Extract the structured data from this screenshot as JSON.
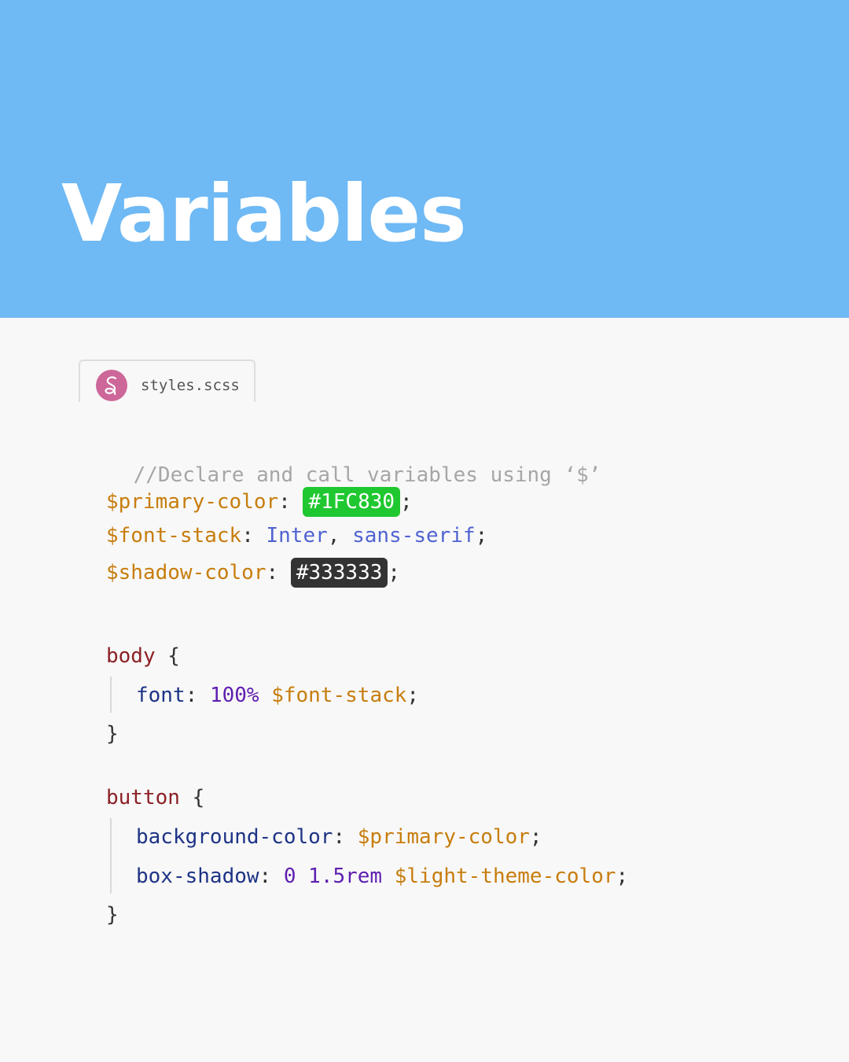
{
  "header": {
    "title": "Variables",
    "background_color": "#6FB9F4"
  },
  "file_tab": {
    "icon": "sass-icon",
    "label": "styles.scss"
  },
  "code": {
    "comment": "//Declare and call variables using ‘$’",
    "variables": [
      {
        "name": "$primary-color",
        "colon": ":",
        "value": "#1FC830",
        "terminator": ";"
      },
      {
        "name": "$font-stack",
        "colon": ":",
        "value_1": "Inter",
        "separator": ",",
        "value_2": "sans-serif",
        "terminator": ";"
      },
      {
        "name": "$shadow-color",
        "colon": ":",
        "value": "#333333",
        "terminator": ";"
      }
    ],
    "rules": [
      {
        "selector": "body",
        "open_brace": "{",
        "declarations": [
          {
            "property": "font",
            "colon": ":",
            "number": "100%",
            "variable": "$font-stack",
            "terminator": ";"
          }
        ],
        "close_brace": "}"
      },
      {
        "selector": "button",
        "open_brace": "{",
        "declarations": [
          {
            "property": "background-color",
            "colon": ":",
            "variable": "$primary-color",
            "terminator": ";"
          },
          {
            "property": "box-shadow",
            "colon": ":",
            "number": "0 1.5rem",
            "variable": "$light-theme-color",
            "terminator": ";"
          }
        ],
        "close_brace": "}"
      }
    ]
  },
  "colors": {
    "page_background": "#F8F8F8",
    "comment": "#A6A6A6",
    "variable": "#C77D0E",
    "property": "#1D3385",
    "value": "#5063D1",
    "number": "#5E1EB0",
    "selector": "#8C2025",
    "chip_green": "#1FC830",
    "chip_dark": "#333333"
  }
}
